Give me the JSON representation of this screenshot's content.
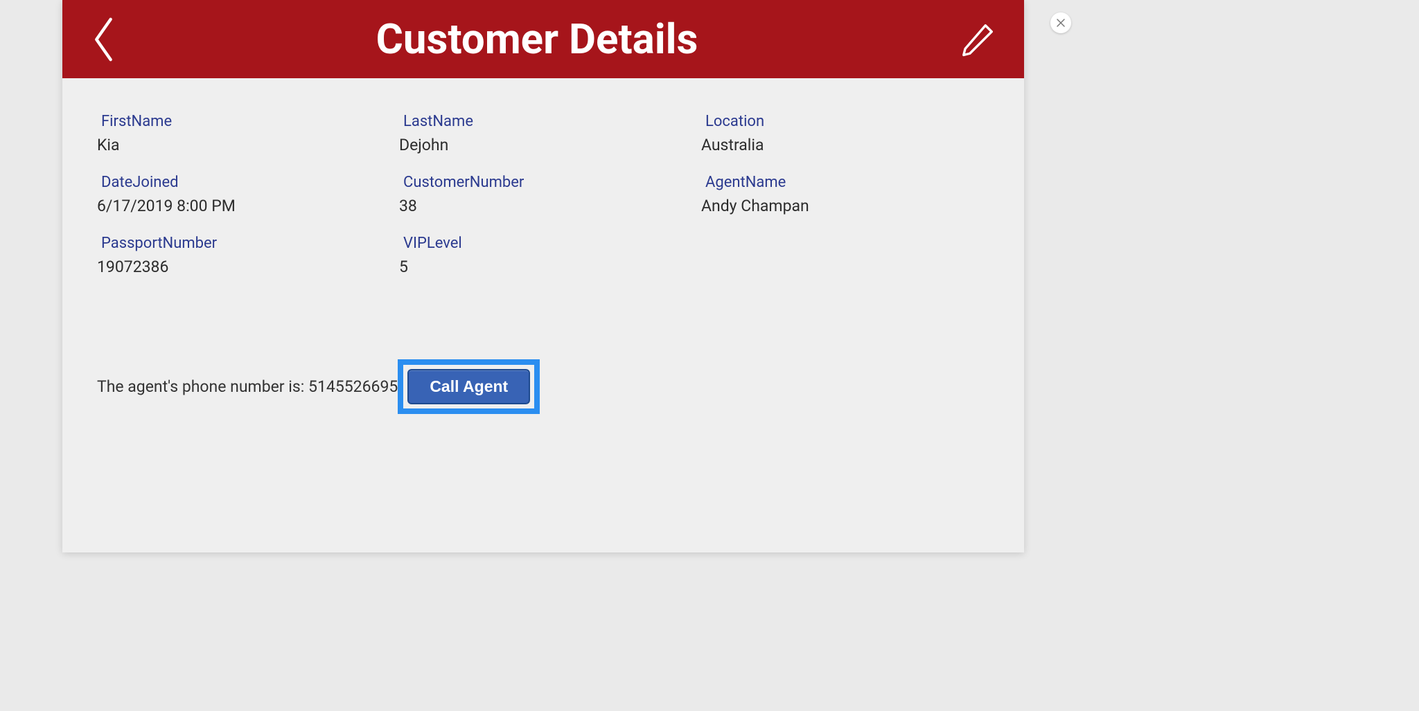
{
  "header": {
    "title": "Customer Details"
  },
  "fields": {
    "firstName": {
      "label": "FirstName",
      "value": "Kia"
    },
    "lastName": {
      "label": "LastName",
      "value": "Dejohn"
    },
    "location": {
      "label": "Location",
      "value": "Australia"
    },
    "dateJoined": {
      "label": "DateJoined",
      "value": "6/17/2019 8:00 PM"
    },
    "customerNumber": {
      "label": "CustomerNumber",
      "value": "38"
    },
    "agentName": {
      "label": "AgentName",
      "value": "Andy Champan"
    },
    "passportNumber": {
      "label": "PassportNumber",
      "value": "19072386"
    },
    "vipLevel": {
      "label": "VIPLevel",
      "value": "5"
    }
  },
  "phone": {
    "prefix": "The agent's phone number is: ",
    "number": "5145526695",
    "callLabel": "Call Agent"
  }
}
